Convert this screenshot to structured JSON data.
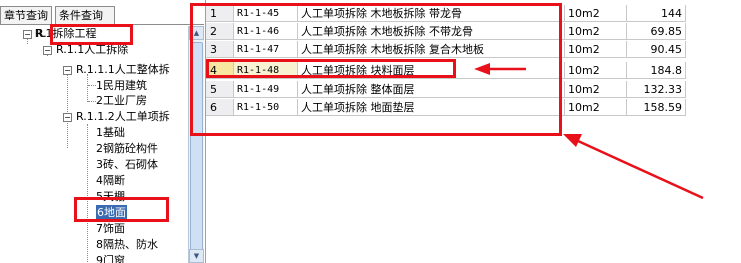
{
  "tabs": [
    "章节查询",
    "条件查询"
  ],
  "tree": {
    "root": "R.1拆除工程",
    "n1": "R.1.1人工拆除",
    "n11": "R.1.1.1人工整体拆",
    "n111": "1民用建筑",
    "n112": "2工业厂房",
    "n12": "R.1.1.2人工单项拆",
    "items": [
      "1基础",
      "2钢筋砼构件",
      "3砖、石砌体",
      "4隔断",
      "5天棚",
      "6地面",
      "7饰面",
      "8隔热、防水",
      "9门窗"
    ]
  },
  "table": {
    "rows": [
      {
        "num": "1",
        "code": "R1-1-45",
        "name": "人工单项拆除 木地板拆除 带龙骨",
        "unit": "10m2",
        "qty": "144"
      },
      {
        "num": "2",
        "code": "R1-1-46",
        "name": "人工单项拆除 木地板拆除 不带龙骨",
        "unit": "10m2",
        "qty": "69.85"
      },
      {
        "num": "3",
        "code": "R1-1-47",
        "name": "人工单项拆除 木地板拆除 复合木地板",
        "unit": "10m2",
        "qty": "90.45"
      },
      {
        "num": "4",
        "code": "R1-1-48",
        "name": "人工单项拆除 块料面层",
        "unit": "10m2",
        "qty": "184.8"
      },
      {
        "num": "5",
        "code": "R1-1-49",
        "name": "人工单项拆除 整体面层",
        "unit": "10m2",
        "qty": "132.33"
      },
      {
        "num": "6",
        "code": "R1-1-50",
        "name": "人工单项拆除 地面垫层",
        "unit": "10m2",
        "qty": "158.59"
      }
    ]
  },
  "colors": {
    "annotation": "#e8111a",
    "selected_row": "#f6e6a0"
  }
}
